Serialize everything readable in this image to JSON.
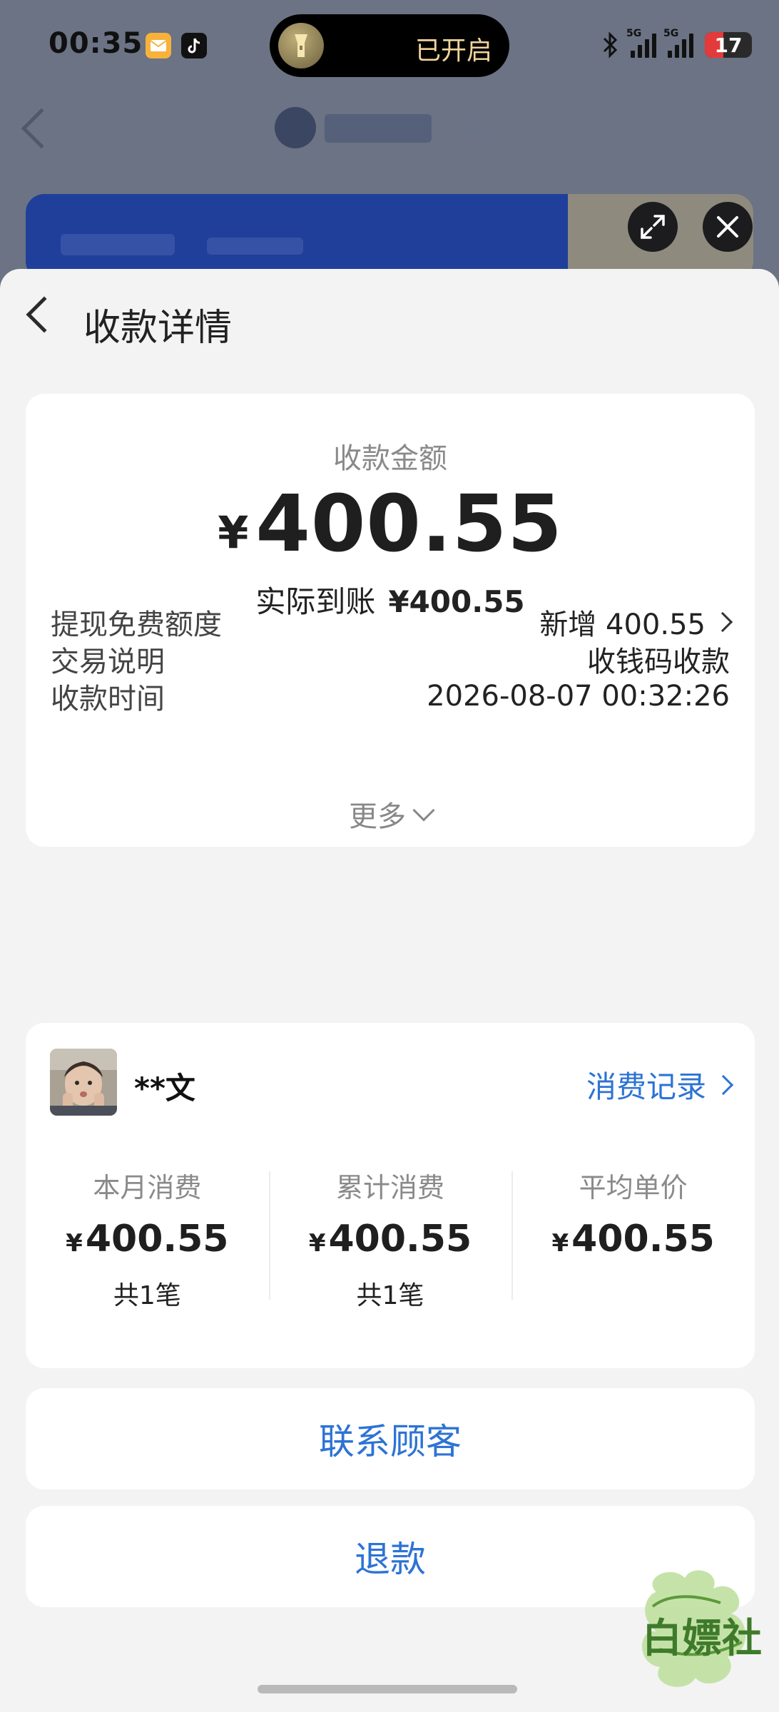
{
  "status_bar": {
    "time": "00:35",
    "live_activity_text": "已开启",
    "network_1": "5G",
    "network_2": "5G",
    "battery": "17",
    "battery_fraction": 0.17
  },
  "sheet": {
    "title": "收款详情"
  },
  "summary": {
    "amount_label": "收款金额",
    "currency": "¥",
    "amount": "400.55",
    "actual_label": "实际到账",
    "actual_value": "¥400.55"
  },
  "details": [
    {
      "label": "提现免费额度",
      "value": "新增 400.55"
    },
    {
      "label": "交易说明",
      "value": "收钱码收款"
    },
    {
      "label": "收款时间",
      "value": "2026-08-07 00:32:26"
    }
  ],
  "more_label": "更多",
  "customer": {
    "name": "**文",
    "link_label": "消费记录",
    "stats": [
      {
        "label": "本月消费",
        "currency": "¥",
        "value": "400.55",
        "count": "共1笔"
      },
      {
        "label": "累计消费",
        "currency": "¥",
        "value": "400.55",
        "count": "共1笔"
      },
      {
        "label": "平均单价",
        "currency": "¥",
        "value": "400.55",
        "count": ""
      }
    ]
  },
  "actions": {
    "contact": "联系顾客",
    "refund": "退款"
  },
  "watermark": "白嫖社",
  "colors": {
    "accent": "#2d73d4",
    "sheet_bg": "#f3f3f3",
    "battery_low": "#e33a3a"
  }
}
